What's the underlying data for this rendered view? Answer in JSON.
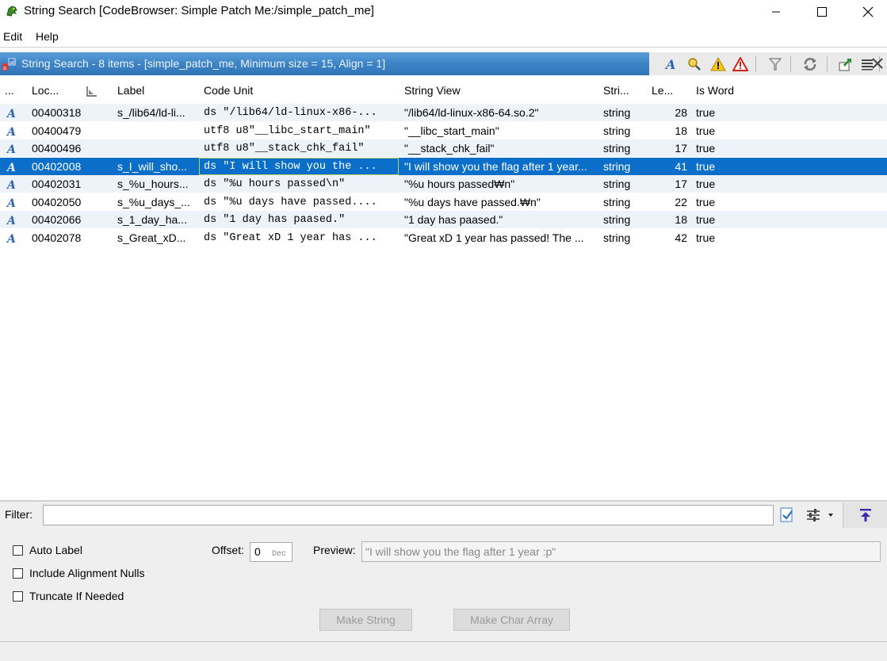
{
  "window": {
    "title": "String Search [CodeBrowser: Simple Patch Me:/simple_patch_me]",
    "icon": "ghidra-dragon-icon"
  },
  "menu": [
    "Edit",
    "Help"
  ],
  "panel": {
    "title": "String Search - 8 items - [simple_patch_me, Minimum size = 15, Align = 1]"
  },
  "table": {
    "headers": [
      "...",
      "Loc...",
      "Label",
      "Code Unit",
      "String View",
      "Stri...",
      "Le...",
      "Is Word"
    ],
    "rows": [
      {
        "location": "00400318",
        "label": "s_/lib64/ld-li...",
        "code_unit": "ds \"/lib64/ld-linux-x86-...",
        "string_view": "\"/lib64/ld-linux-x86-64.so.2\"",
        "type": "string",
        "length": "28",
        "is_word": "true"
      },
      {
        "location": "00400479",
        "label": "",
        "code_unit": "utf8 u8\"__libc_start_main\"",
        "string_view": "\"__libc_start_main\"",
        "type": "string",
        "length": "18",
        "is_word": "true"
      },
      {
        "location": "00400496",
        "label": "",
        "code_unit": "utf8 u8\"__stack_chk_fail\"",
        "string_view": "\"__stack_chk_fail\"",
        "type": "string",
        "length": "17",
        "is_word": "true"
      },
      {
        "location": "00402008",
        "label": "s_I_will_sho...",
        "code_unit": "ds \"I will show you the ...",
        "string_view": "\"I will show you the flag after 1 year...",
        "type": "string",
        "length": "41",
        "is_word": "true"
      },
      {
        "location": "00402031",
        "label": "s_%u_hours...",
        "code_unit": "ds \"%u hours passed\\n\"",
        "string_view": "\"%u hours passed₩n\"",
        "type": "string",
        "length": "17",
        "is_word": "true"
      },
      {
        "location": "00402050",
        "label": "s_%u_days_...",
        "code_unit": "ds \"%u days have passed....",
        "string_view": "\"%u days have passed.₩n\"",
        "type": "string",
        "length": "22",
        "is_word": "true"
      },
      {
        "location": "00402066",
        "label": "s_1_day_ha...",
        "code_unit": "ds \"1 day has paased.\"",
        "string_view": "\"1 day has paased.\"",
        "type": "string",
        "length": "18",
        "is_word": "true"
      },
      {
        "location": "00402078",
        "label": "s_Great_xD...",
        "code_unit": "ds \"Great xD 1 year has ...",
        "string_view": "\"Great xD 1 year has passed! The ...",
        "type": "string",
        "length": "42",
        "is_word": "true"
      }
    ],
    "selected_row": 3
  },
  "filter": {
    "label": "Filter:",
    "value": ""
  },
  "options": {
    "auto_label": "Auto Label",
    "include_alignment_nulls": "Include Alignment Nulls",
    "truncate_if_needed": "Truncate If Needed"
  },
  "offset": {
    "label": "Offset:",
    "value": "0",
    "unit": "Dec"
  },
  "preview": {
    "label": "Preview:",
    "value": "\"I will show you the flag after 1 year :p\""
  },
  "buttons": {
    "make_string": "Make String",
    "make_char_array": "Make Char Array"
  },
  "colors": {
    "header_blue": "#3d84c6",
    "selection": "#0b6fc9",
    "row_alt": "#eef3fa"
  }
}
